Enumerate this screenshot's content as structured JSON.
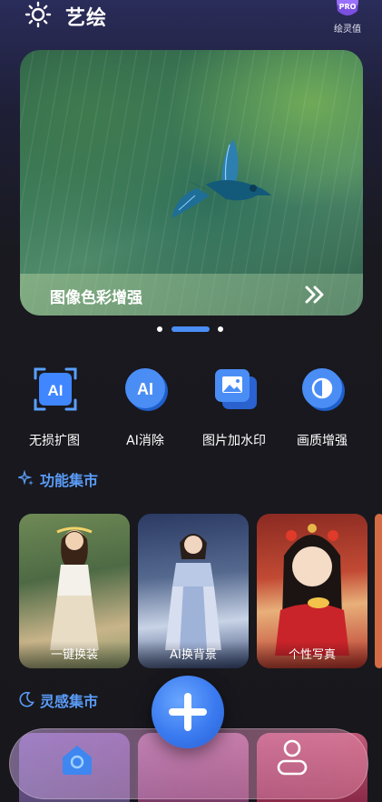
{
  "header": {
    "app_title": "艺绘",
    "pro_badge": "PRO",
    "pro_label": "绘灵值"
  },
  "banner": {
    "title": "图像色彩增强",
    "slides_total": 3,
    "active_slide": 2
  },
  "tools": [
    {
      "label": "无损扩图",
      "icon": "ai-expand-icon"
    },
    {
      "label": "AI消除",
      "icon": "ai-erase-icon"
    },
    {
      "label": "图片加水印",
      "icon": "image-watermark-icon"
    },
    {
      "label": "画质增强",
      "icon": "quality-enhance-icon"
    }
  ],
  "tool_icon_text": {
    "ai": "AI"
  },
  "sections": {
    "features": {
      "title": "功能集市"
    },
    "inspiration": {
      "title": "灵感集市"
    }
  },
  "feature_cards": [
    {
      "label": "一键换装"
    },
    {
      "label": "AI换背景"
    },
    {
      "label": "个性写真"
    }
  ],
  "colors": {
    "accent": "#4a8df5",
    "section_title": "#5a9cf8",
    "background": "#17171c"
  }
}
